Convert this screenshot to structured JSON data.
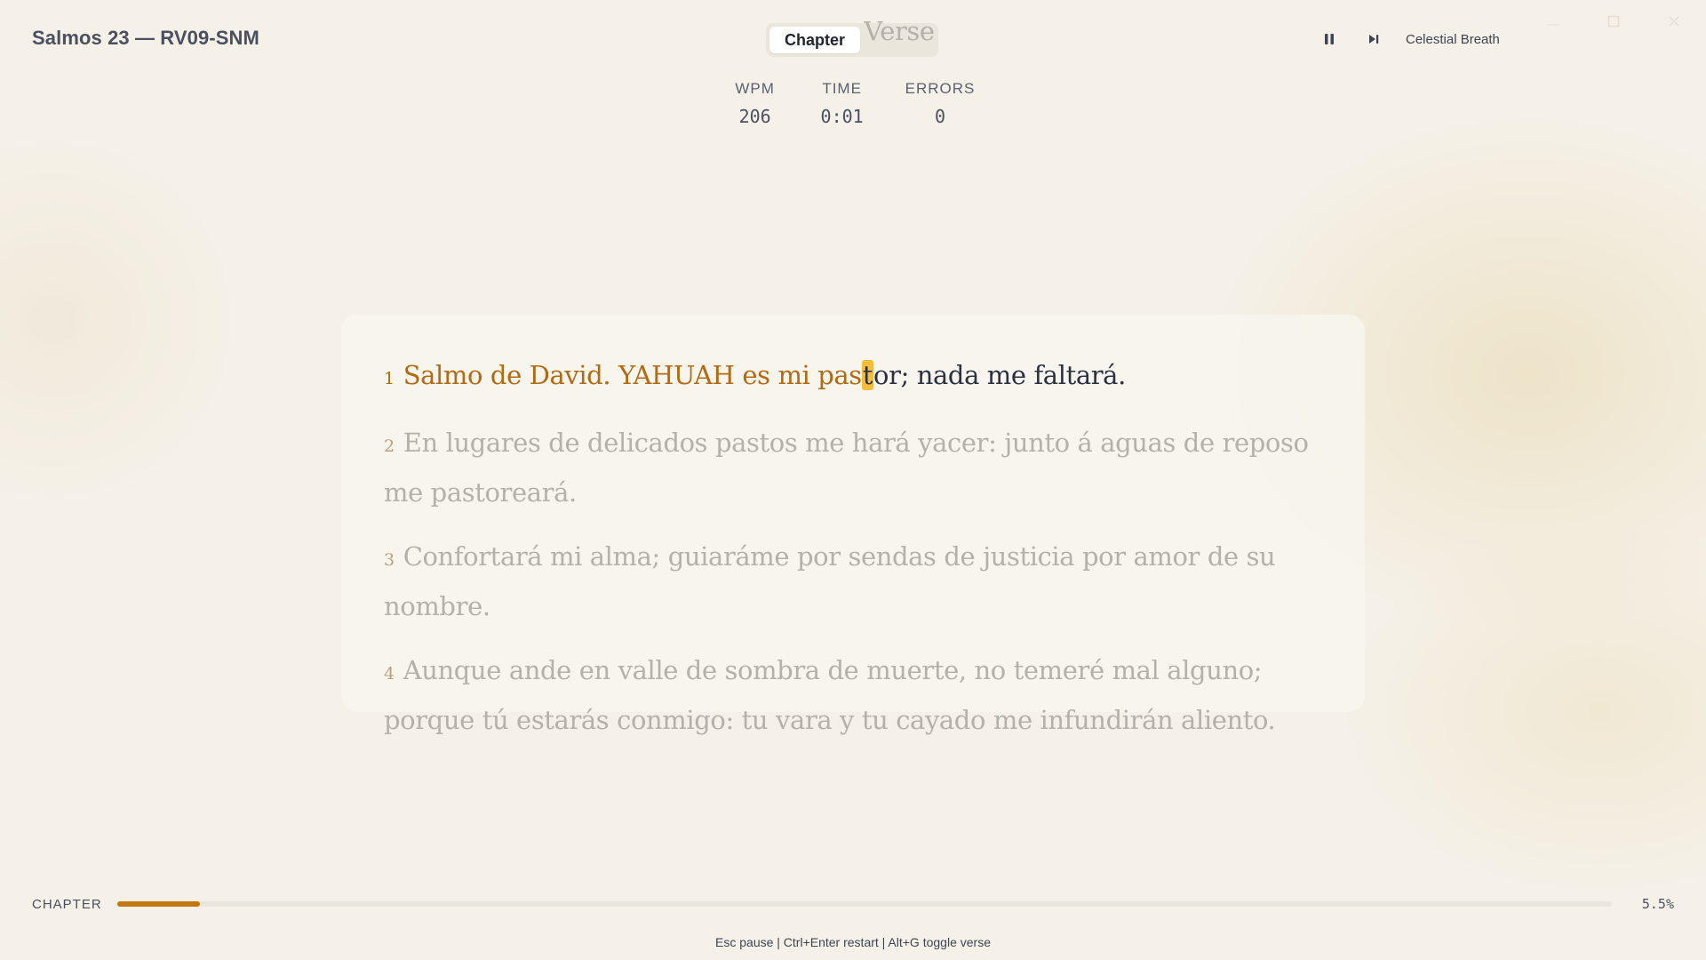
{
  "header": {
    "title": "Salmos 23 — RV09-SNM",
    "modes": [
      {
        "label": "Chapter",
        "active": true
      },
      {
        "label": "Verse",
        "active": false
      }
    ]
  },
  "stats": [
    {
      "label": "WPM",
      "value": "206"
    },
    {
      "label": "TIME",
      "value": "0:01"
    },
    {
      "label": "ERRORS",
      "value": "0"
    }
  ],
  "player": {
    "pause_icon": "pause-icon",
    "skip_icon": "skip-forward-icon",
    "track": "Celestial Breath"
  },
  "window_controls": [
    "minimize-icon",
    "maximize-icon",
    "close-icon"
  ],
  "passage": {
    "current": {
      "number": "1",
      "typed": "Salmo de David. YAHUAH es mi pas",
      "cursor": "t",
      "remaining": "or; nada me faltará."
    },
    "upcoming": [
      {
        "number": "2",
        "text": "En lugares de delicados pastos me hará yacer: junto á aguas de reposo me pastoreará."
      },
      {
        "number": "3",
        "text": "Confortará mi alma; guiaráme por sendas de justicia por amor de su nombre."
      },
      {
        "number": "4",
        "text": "Aunque ande en valle de sombra de muerte, no temeré mal alguno; porque tú estarás conmigo: tu vara y tu cayado me infundirán aliento."
      }
    ]
  },
  "progress": {
    "label": "CHAPTER",
    "fraction": 0.055,
    "percent_text": "5.5%"
  },
  "footer": {
    "hints": "Esc pause | Ctrl+Enter restart | Alt+G toggle verse"
  },
  "colors": {
    "accent": "#c27710",
    "cursor": "#f5bd3a",
    "background": "#f5f1e8"
  }
}
